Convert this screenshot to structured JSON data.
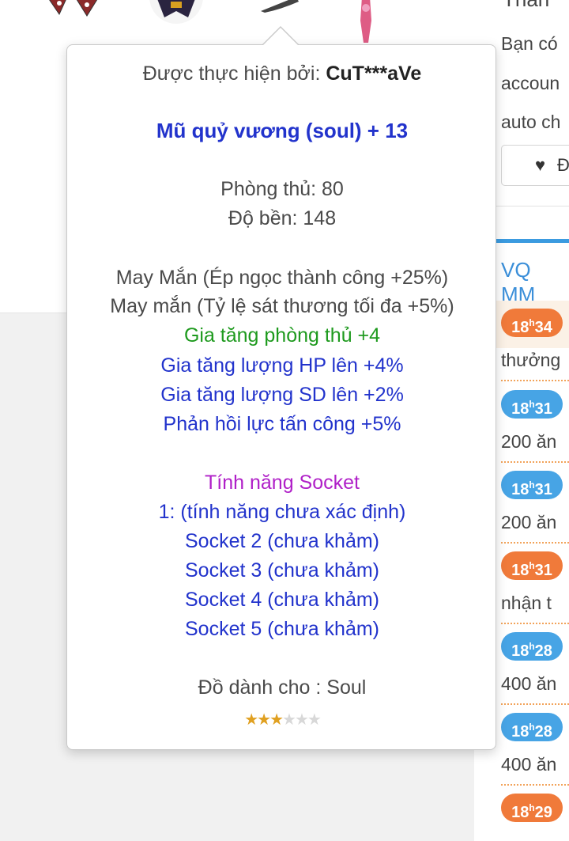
{
  "tooltip": {
    "made_by_label": "Được thực hiện bởi:",
    "made_by_user": "CuT***aVe",
    "item_name": "Mũ quỷ vương (soul) + 13",
    "defense": "Phòng thủ: 80",
    "durability": "Độ bền: 148",
    "luck_1": "May Mắn (Ép ngọc thành công +25%)",
    "luck_2": "May mắn (Tỷ lệ sát thương tối đa +5%)",
    "opt_defense": "Gia tăng phòng thủ +4",
    "opt_hp": "Gia tăng lượng HP lên +4%",
    "opt_sd": "Gia tăng lượng SD lên +2%",
    "opt_reflect": "Phản hồi lực tấn công +5%",
    "socket_title": "Tính năng Socket",
    "socket_1": "1: (tính năng chưa xác định)",
    "socket_2": "Socket 2 (chưa khảm)",
    "socket_3": "Socket 3 (chưa khảm)",
    "socket_4": "Socket 4 (chưa khảm)",
    "socket_5": "Socket 5 (chưa khảm)",
    "class_for": "Đồ dành cho : Soul",
    "rating": 3,
    "rating_max": 6
  },
  "right_panel": {
    "title": "Thân",
    "desc_1": "Bạn có",
    "desc_2": "accoun",
    "desc_3": "auto ch",
    "fav_label": "Đ",
    "news_title": "VQ MM",
    "news": [
      {
        "hour": "18",
        "minute": "34",
        "text": "thưởng",
        "color": "orange"
      },
      {
        "hour": "18",
        "minute": "31",
        "text": "200 ăn",
        "color": "blue"
      },
      {
        "hour": "18",
        "minute": "31",
        "text": "200 ăn",
        "color": "blue"
      },
      {
        "hour": "18",
        "minute": "31",
        "text": "nhận t",
        "color": "orange"
      },
      {
        "hour": "18",
        "minute": "28",
        "text": "400 ăn",
        "color": "blue"
      },
      {
        "hour": "18",
        "minute": "28",
        "text": "400 ăn",
        "color": "blue"
      },
      {
        "hour": "18",
        "minute": "29",
        "text": "",
        "color": "orange"
      }
    ]
  },
  "colors": {
    "item_name": "#2233cc",
    "excellent": "#2233cc",
    "green_option": "#1e9a1e",
    "socket_title": "#b020c8",
    "badge_orange": "#f07a3a",
    "badge_blue": "#47a4e5",
    "news_title": "#3b8fd9"
  }
}
